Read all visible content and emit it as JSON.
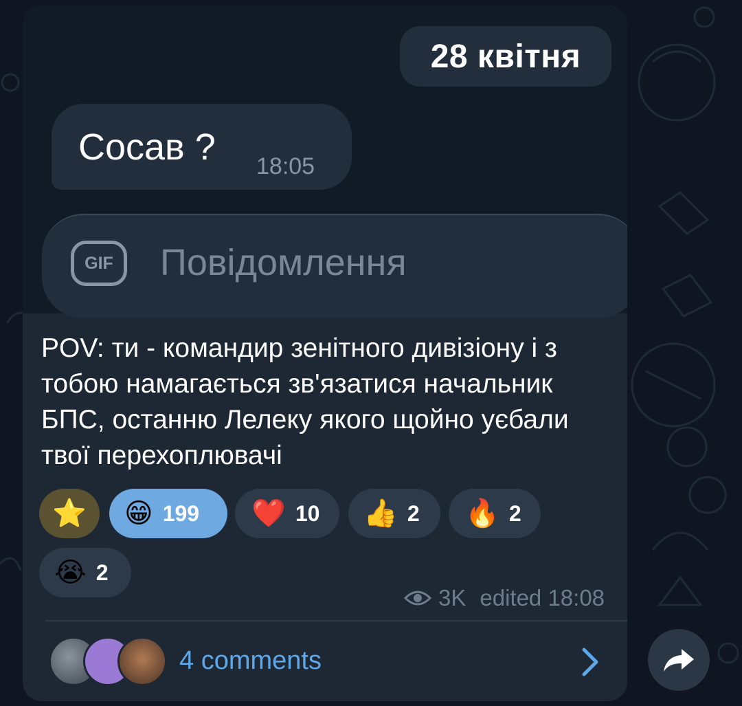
{
  "screenshot": {
    "date_label": "28 квітня",
    "message_text": "Сосав ?",
    "message_time": "18:05",
    "gif_label": "GIF",
    "input_placeholder": "Повідомлення"
  },
  "post": {
    "text": "POV: ти - командир зенітного дивізіону і з тобою намагається зв'язатися начальник БПС, останню Лелеку якого щойно уєбали твої перехоплювачі"
  },
  "reactions": [
    {
      "emoji": "⭐",
      "count": "",
      "type": "star"
    },
    {
      "emoji": "😁",
      "count": "199",
      "selected": true
    },
    {
      "emoji": "❤️",
      "count": "10"
    },
    {
      "emoji": "👍",
      "count": "2"
    },
    {
      "emoji": "🔥",
      "count": "2"
    },
    {
      "emoji": "😭",
      "count": "2"
    }
  ],
  "meta": {
    "views": "3K",
    "edited": "edited 18:08",
    "views_icon": "eye-icon"
  },
  "comments": {
    "label": "4 comments",
    "chevron_icon": "chevron-right-icon"
  },
  "share": {
    "icon": "share-arrow-icon"
  },
  "colors": {
    "background": "#0f1621",
    "card": "#1d2834",
    "accent_link": "#5ea7e8",
    "selected_reaction": "#6fa9e1"
  }
}
